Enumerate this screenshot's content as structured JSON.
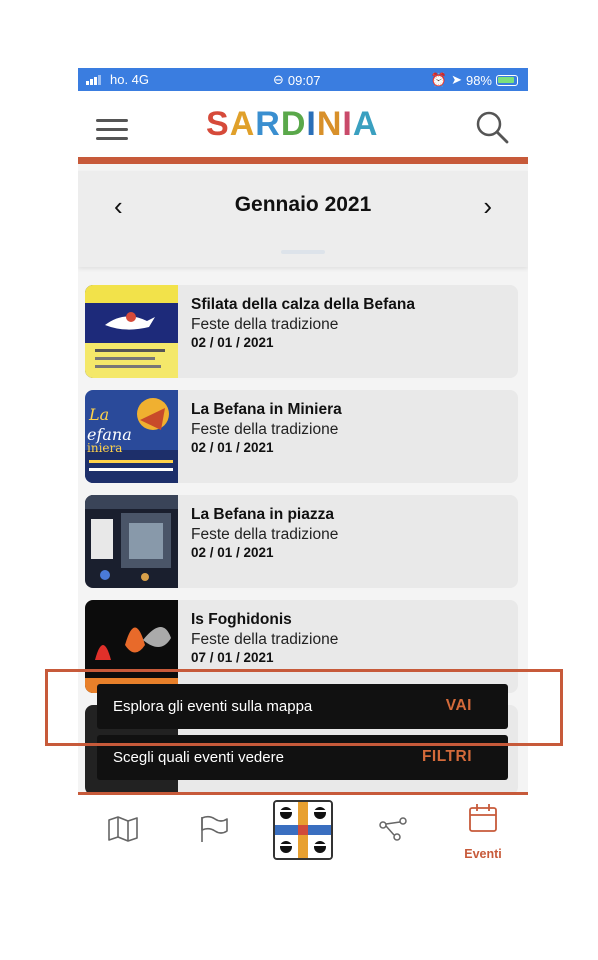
{
  "status_bar": {
    "carrier": "ho. 4G",
    "time": "09:07",
    "battery": "98%"
  },
  "header": {
    "logo_text": "SARDINIA",
    "logo_colors": [
      "#d64a3a",
      "#e0a02a",
      "#3a8fd0",
      "#5aa84a",
      "#2a6fb8",
      "#d8902a",
      "#c94a6a",
      "#3aa0c0"
    ]
  },
  "calendar": {
    "month_title": "Gennaio 2021",
    "prev_symbol": "‹",
    "next_symbol": "›"
  },
  "events": [
    {
      "title": "Sfilata della calza della Befana",
      "category": "Feste della tradizione",
      "date": "02 / 01 / 2021"
    },
    {
      "title": "La Befana in Miniera",
      "category": "Feste della tradizione",
      "date": "02 / 01 / 2021"
    },
    {
      "title": "La Befana in piazza",
      "category": "Feste della tradizione",
      "date": "02 / 01 / 2021"
    },
    {
      "title": "Is Foghidonis",
      "category": "Feste della tradizione",
      "date": "07 / 01 / 2021"
    }
  ],
  "snackbars": [
    {
      "message": "Esplora gli eventi sulla mappa",
      "action": "VAI"
    },
    {
      "message": "Scegli quali eventi vedere",
      "action": "FILTRI"
    }
  ],
  "tabbar": {
    "tabs": [
      "map-icon",
      "flag-icon",
      "sardinia-flag",
      "share-icon",
      "calendar-icon"
    ],
    "active_label": "Eventi"
  },
  "colors": {
    "accent": "#c75a3a",
    "status_bar": "#3a7de0",
    "snackbar_bg": "#111111"
  }
}
